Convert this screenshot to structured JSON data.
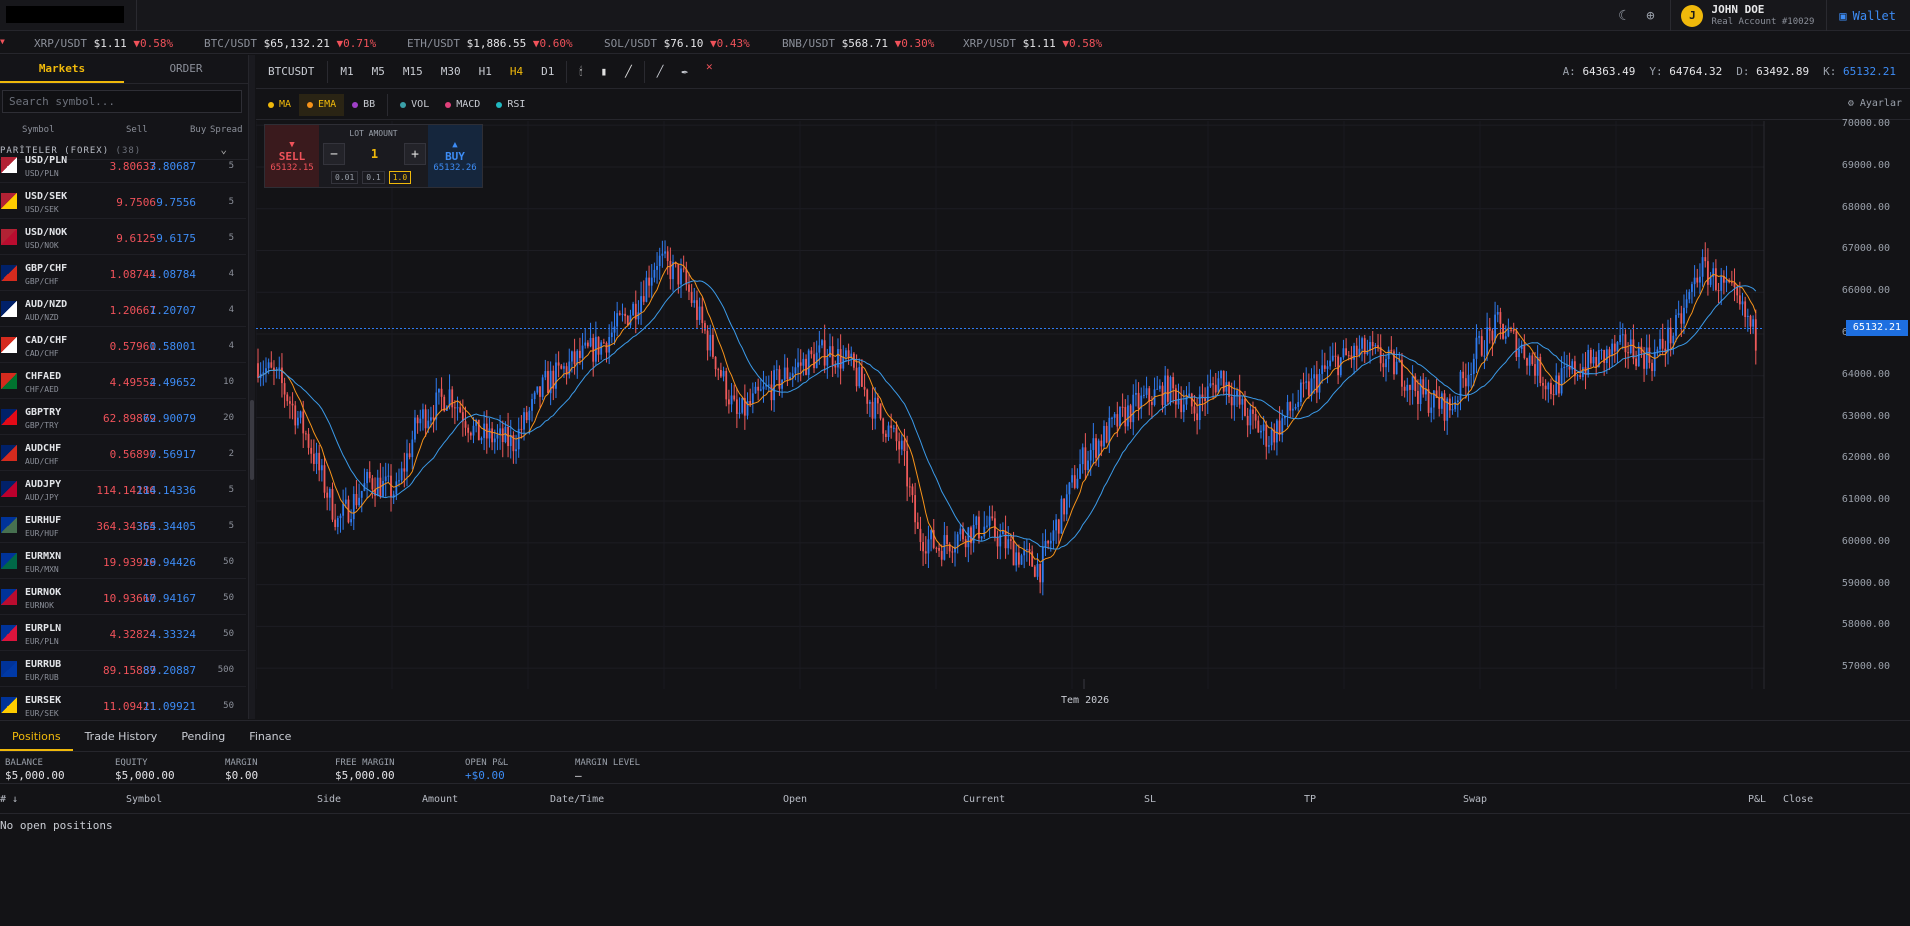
{
  "account": {
    "initial": "J",
    "name": "JOHN DOE",
    "type": "Real Account #10029",
    "wallet_label": "Wallet"
  },
  "ticker": [
    {
      "symbol": "XRP/USDT",
      "price": "$1.11",
      "change": "▼0.58%"
    },
    {
      "symbol": "BTC/USDT",
      "price": "$65,132.21",
      "change": "▼0.71%"
    },
    {
      "symbol": "ETH/USDT",
      "price": "$1,886.55",
      "change": "▼0.60%"
    },
    {
      "symbol": "SOL/USDT",
      "price": "$76.10",
      "change": "▼0.43%"
    },
    {
      "symbol": "BNB/USDT",
      "price": "$568.71",
      "change": "▼0.30%"
    },
    {
      "symbol": "XRP/USDT",
      "price": "$1.11",
      "change": "▼0.58%"
    }
  ],
  "sidebar": {
    "tabs": [
      "Markets",
      "ORDER"
    ],
    "search_placeholder": "Search symbol...",
    "columns": {
      "symbol": "Symbol",
      "sell": "Sell",
      "buy": "Buy",
      "spread": "Spread"
    },
    "group": {
      "name": "PARİTELER (FOREX)",
      "count": "(38)"
    },
    "pairs": [
      {
        "sym": "USD/PLN",
        "sub": "USD/PLN",
        "sell": "3.80637",
        "buy": "3.80687",
        "spread": "5"
      },
      {
        "sym": "USD/SEK",
        "sub": "USD/SEK",
        "sell": "9.7506",
        "buy": "9.7556",
        "spread": "5"
      },
      {
        "sym": "USD/NOK",
        "sub": "USD/NOK",
        "sell": "9.6125",
        "buy": "9.6175",
        "spread": "5"
      },
      {
        "sym": "GBP/CHF",
        "sub": "GBP/CHF",
        "sell": "1.08744",
        "buy": "1.08784",
        "spread": "4"
      },
      {
        "sym": "AUD/NZD",
        "sub": "AUD/NZD",
        "sell": "1.20667",
        "buy": "1.20707",
        "spread": "4"
      },
      {
        "sym": "CAD/CHF",
        "sub": "CAD/CHF",
        "sell": "0.57961",
        "buy": "0.58001",
        "spread": "4"
      },
      {
        "sym": "CHFAED",
        "sub": "CHF/AED",
        "sell": "4.49552",
        "buy": "4.49652",
        "spread": "10"
      },
      {
        "sym": "GBPTRY",
        "sub": "GBP/TRY",
        "sell": "62.89879",
        "buy": "62.90079",
        "spread": "20"
      },
      {
        "sym": "AUDCHF",
        "sub": "AUD/CHF",
        "sell": "0.56897",
        "buy": "0.56917",
        "spread": "2"
      },
      {
        "sym": "AUDJPY",
        "sub": "AUD/JPY",
        "sell": "114.14286",
        "buy": "114.14336",
        "spread": "5"
      },
      {
        "sym": "EURHUF",
        "sub": "EUR/HUF",
        "sell": "364.34355",
        "buy": "364.34405",
        "spread": "5"
      },
      {
        "sym": "EURMXN",
        "sub": "EUR/MXN",
        "sell": "19.93926",
        "buy": "19.94426",
        "spread": "50"
      },
      {
        "sym": "EURNOK",
        "sub": "EURNOK",
        "sell": "10.93667",
        "buy": "10.94167",
        "spread": "50"
      },
      {
        "sym": "EURPLN",
        "sub": "EUR/PLN",
        "sell": "4.32824",
        "buy": "4.33324",
        "spread": "50"
      },
      {
        "sym": "EURRUB",
        "sub": "EUR/RUB",
        "sell": "89.15887",
        "buy": "89.20887",
        "spread": "500"
      },
      {
        "sym": "EURSEK",
        "sub": "EUR/SEK",
        "sell": "11.09421",
        "buy": "11.09921",
        "spread": "50"
      }
    ]
  },
  "toolbar": {
    "symbol": "BTCUSDT",
    "timeframes": [
      "M1",
      "M5",
      "M15",
      "M30",
      "H1",
      "H4",
      "D1"
    ],
    "active_tf": "H4"
  },
  "ohlc": [
    {
      "k": "A:",
      "v": "64363.49"
    },
    {
      "k": "Y:",
      "v": "64764.32"
    },
    {
      "k": "D:",
      "v": "63492.89"
    },
    {
      "k": "K:",
      "v": "65132.21"
    }
  ],
  "indicators": [
    {
      "name": "MA",
      "color": "#f0b90b"
    },
    {
      "name": "EMA",
      "color": "#f7931a"
    },
    {
      "name": "BB",
      "color": "#a040c8"
    },
    {
      "name": "VOL",
      "color": "#3aa0a8"
    },
    {
      "name": "MACD",
      "color": "#e0407a"
    },
    {
      "name": "RSI",
      "color": "#20b8c0"
    }
  ],
  "settings_label": "⚙ Ayarlar",
  "trade_panel": {
    "sell_label": "SELL",
    "sell_price": "65132.15",
    "buy_label": "BUY",
    "buy_price": "65132.26",
    "lot_label": "LOT AMOUNT",
    "lot_value": "1",
    "lot_presets": [
      "0.01",
      "0.1",
      "1.0"
    ]
  },
  "chart_data": {
    "type": "candlestick",
    "symbol": "BTCUSDT",
    "timeframe": "H4",
    "y_ticks": [
      70000,
      69000,
      68000,
      67000,
      66000,
      65000,
      64000,
      63000,
      62000,
      61000,
      60000,
      59000,
      58000,
      57000
    ],
    "ylim": [
      56500,
      70100
    ],
    "x_label": "Tem 2026",
    "current_price": "65132.21",
    "close_path": [
      [
        0,
        64300
      ],
      [
        8,
        63900
      ],
      [
        18,
        62600
      ],
      [
        30,
        60500
      ],
      [
        42,
        61500
      ],
      [
        52,
        61200
      ],
      [
        60,
        62900
      ],
      [
        72,
        63600
      ],
      [
        82,
        62600
      ],
      [
        96,
        62400
      ],
      [
        108,
        63800
      ],
      [
        118,
        64300
      ],
      [
        130,
        64800
      ],
      [
        142,
        65700
      ],
      [
        150,
        66800
      ],
      [
        160,
        66300
      ],
      [
        172,
        64400
      ],
      [
        180,
        63000
      ],
      [
        190,
        63600
      ],
      [
        202,
        64200
      ],
      [
        214,
        64600
      ],
      [
        222,
        64300
      ],
      [
        232,
        63200
      ],
      [
        242,
        62200
      ],
      [
        248,
        60200
      ],
      [
        256,
        59900
      ],
      [
        264,
        60200
      ],
      [
        274,
        60400
      ],
      [
        284,
        59800
      ],
      [
        294,
        59400
      ],
      [
        300,
        60400
      ],
      [
        310,
        62000
      ],
      [
        320,
        62700
      ],
      [
        330,
        63300
      ],
      [
        342,
        63700
      ],
      [
        352,
        63200
      ],
      [
        362,
        64000
      ],
      [
        372,
        63000
      ],
      [
        380,
        62500
      ],
      [
        392,
        63500
      ],
      [
        404,
        64300
      ],
      [
        416,
        64600
      ],
      [
        428,
        64200
      ],
      [
        438,
        63500
      ],
      [
        448,
        63200
      ],
      [
        458,
        64600
      ],
      [
        466,
        65200
      ],
      [
        476,
        64600
      ],
      [
        486,
        63700
      ],
      [
        494,
        64100
      ],
      [
        504,
        64400
      ],
      [
        514,
        64700
      ],
      [
        524,
        64400
      ],
      [
        534,
        65200
      ],
      [
        542,
        66600
      ],
      [
        548,
        66300
      ],
      [
        554,
        65900
      ],
      [
        560,
        65300
      ],
      [
        563,
        64900
      ]
    ]
  },
  "bottom": {
    "tabs": [
      "Positions",
      "Trade History",
      "Pending",
      "Finance"
    ],
    "stats": [
      {
        "k": "BALANCE",
        "v": "$5,000.00"
      },
      {
        "k": "EQUITY",
        "v": "$5,000.00"
      },
      {
        "k": "MARGIN",
        "v": "$0.00"
      },
      {
        "k": "FREE MARGIN",
        "v": "$5,000.00"
      },
      {
        "k": "OPEN P&L",
        "v": "+$0.00"
      },
      {
        "k": "MARGIN LEVEL",
        "v": "—"
      }
    ],
    "columns": [
      "# ↓",
      "Symbol",
      "Side",
      "Amount",
      "Date/Time",
      "Open",
      "Current",
      "SL",
      "TP",
      "Swap",
      "P&L",
      "Close"
    ],
    "empty_text": "No open positions"
  }
}
